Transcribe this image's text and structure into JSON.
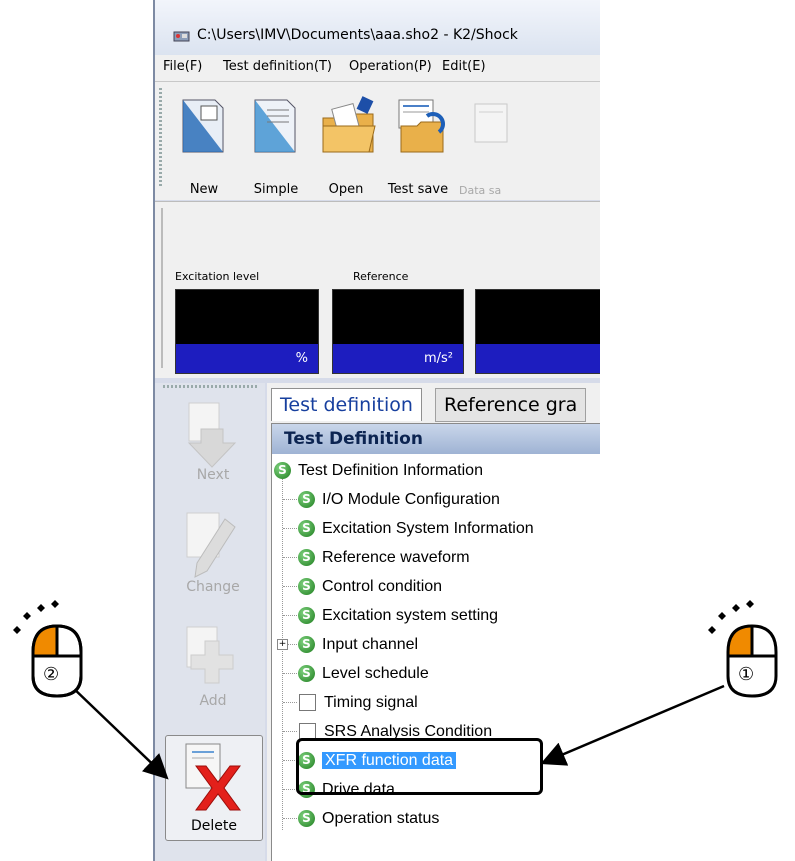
{
  "window": {
    "title": "C:\\Users\\IMV\\Documents\\aaa.sho2 - K2/Shock"
  },
  "menu": [
    "File(F)",
    "Test definition(T)",
    "Operation(P)",
    "Edit(E)"
  ],
  "toolbar": {
    "items": [
      {
        "label": "New",
        "icon": "new-document-icon"
      },
      {
        "label": "Simple",
        "icon": "simple-document-icon"
      },
      {
        "label": "Open",
        "icon": "open-folder-icon"
      },
      {
        "label": "Test save",
        "icon": "test-save-icon"
      },
      {
        "label": "Data sa",
        "icon": "data-save-icon",
        "disabled": true
      }
    ]
  },
  "status": {
    "meters": [
      {
        "label": "Excitation level",
        "unit": "%"
      },
      {
        "label": "Reference",
        "unit": "m/s²"
      },
      {
        "label": "",
        "unit": ""
      }
    ]
  },
  "side_buttons": [
    {
      "label": "Next",
      "enabled": false
    },
    {
      "label": "Change",
      "enabled": false
    },
    {
      "label": "Add",
      "enabled": false
    },
    {
      "label": "Delete",
      "enabled": true
    }
  ],
  "tabs": [
    {
      "label": "Test definition",
      "active": true
    },
    {
      "label": "Reference gra",
      "active": false
    }
  ],
  "panel": {
    "header": "Test Definition"
  },
  "tree": [
    {
      "label": "Test Definition Information",
      "icon": "s",
      "level": 0
    },
    {
      "label": "I/O Module Configuration",
      "icon": "s",
      "level": 1
    },
    {
      "label": "Excitation System Information",
      "icon": "s",
      "level": 1
    },
    {
      "label": "Reference waveform",
      "icon": "s",
      "level": 1
    },
    {
      "label": "Control condition",
      "icon": "s",
      "level": 1
    },
    {
      "label": "Excitation system setting",
      "icon": "s",
      "level": 1
    },
    {
      "label": "Input channel",
      "icon": "s",
      "level": 1,
      "expandable": true
    },
    {
      "label": "Level schedule",
      "icon": "s",
      "level": 1
    },
    {
      "label": "Timing signal",
      "icon": "checkbox",
      "level": 1
    },
    {
      "label": "SRS Analysis Condition",
      "icon": "checkbox",
      "level": 1
    },
    {
      "label": "XFR function data",
      "icon": "s",
      "level": 1,
      "selected": true
    },
    {
      "label": "Drive data",
      "icon": "s",
      "level": 1
    },
    {
      "label": "Operation status",
      "icon": "s",
      "level": 1
    }
  ],
  "annotations": {
    "step1": "①",
    "step2": "②",
    "mouse_color": "#f08a00"
  }
}
